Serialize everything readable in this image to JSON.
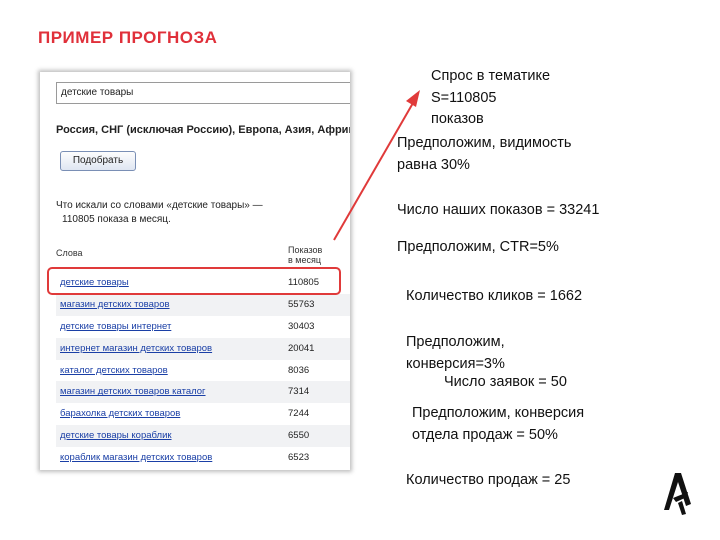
{
  "slide": {
    "title": "ПРИМЕР ПРОГНОЗА"
  },
  "wordstat": {
    "search_value": "детские товары",
    "regions": "Россия, СНГ (исключая Россию), Европа, Азия, Африк",
    "pick_button": "Подобрать",
    "query_line1": "Что искали со словами «детские товары» —",
    "query_line2": "110805 показа в месяц.",
    "col_words": "Слова",
    "col_shows_1": "Показов",
    "col_shows_2": "в месяц",
    "rows": [
      {
        "word": "детские товары",
        "count": "110805"
      },
      {
        "word": "магазин детских товаров",
        "count": "55763"
      },
      {
        "word": "детские товары интернет",
        "count": "30403"
      },
      {
        "word": "интернет магазин детских товаров",
        "count": "20041"
      },
      {
        "word": "каталог детских товаров",
        "count": "8036"
      },
      {
        "word": "магазин детских товаров каталог",
        "count": "7314"
      },
      {
        "word": "барахолка детских товаров",
        "count": "7244"
      },
      {
        "word": "детские товары кораблик",
        "count": "6550"
      },
      {
        "word": "кораблик магазин детских товаров",
        "count": "6523"
      }
    ]
  },
  "notes": {
    "demand_1": "Спрос в тематике",
    "demand_2": "S=110805",
    "demand_3": "показов",
    "visibility_1": "Предположим, видимость",
    "visibility_2": "равна 30%",
    "impressions": "Число наших показов = 33241",
    "ctr": "Предположим, CTR=5%",
    "clicks": "Количество кликов = 1662",
    "conversion_1": "Предположим,",
    "conversion_2": "конверсия=3%",
    "leads": "Число заявок = 50",
    "sales_conv_1": "Предположим, конверсия",
    "sales_conv_2": "отдела продаж = 50%",
    "sales": "Количество продаж = 25"
  },
  "colors": {
    "title": "#e0303a",
    "highlight": "#e03a3a",
    "link": "#1a3fa6"
  },
  "icons": {
    "logo": "arrow-cursor-logo-icon"
  }
}
